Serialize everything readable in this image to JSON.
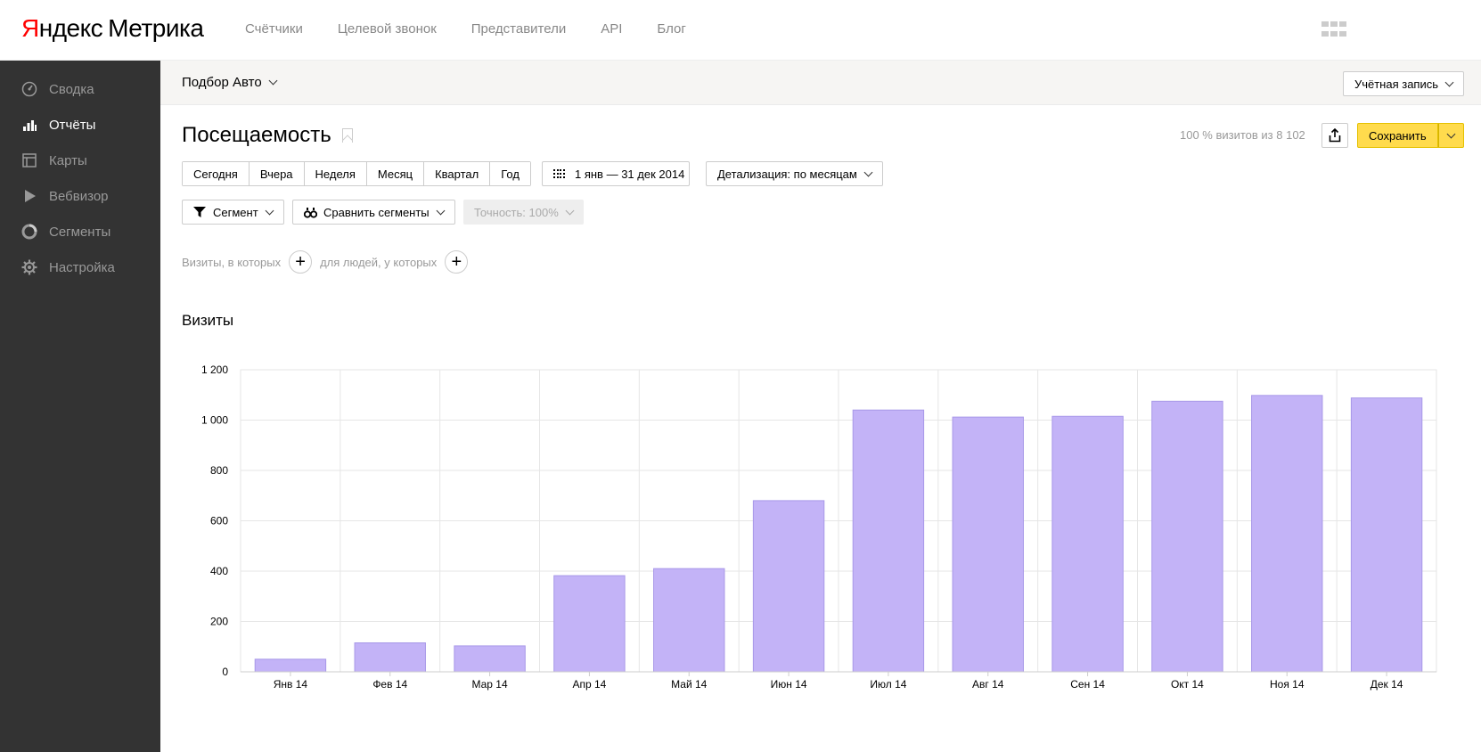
{
  "header": {
    "logo_brand": "Яндекс",
    "logo_product": "Метрика",
    "nav": [
      "Счётчики",
      "Целевой звонок",
      "Представители",
      "API",
      "Блог"
    ]
  },
  "sidebar": {
    "items": [
      {
        "label": "Сводка",
        "icon": "gauge-icon",
        "active": false
      },
      {
        "label": "Отчёты",
        "icon": "bar-chart-icon",
        "active": true
      },
      {
        "label": "Карты",
        "icon": "map-icon",
        "active": false
      },
      {
        "label": "Вебвизор",
        "icon": "play-icon",
        "active": false
      },
      {
        "label": "Сегменты",
        "icon": "segment-icon",
        "active": false
      },
      {
        "label": "Настройка",
        "icon": "gear-icon",
        "active": false
      }
    ]
  },
  "subbar": {
    "counter": "Подбор Авто",
    "account": "Учётная запись"
  },
  "report": {
    "title": "Посещаемость",
    "visits_info": "100 % визитов из 8 102",
    "save_label": "Сохранить",
    "periods": [
      "Сегодня",
      "Вчера",
      "Неделя",
      "Месяц",
      "Квартал",
      "Год"
    ],
    "date_range": "1 янв — 31 дек 2014",
    "detail": "Детализация: по месяцам",
    "segment": "Сегмент",
    "compare": "Сравнить сегменты",
    "accuracy": "Точность: 100%",
    "filter_visits": "Визиты, в которых",
    "filter_people": "для людей, у которых"
  },
  "colors": {
    "bar": "#c3b3f7",
    "bar_stroke": "#a898e8",
    "sidebar_bg": "#333333",
    "save_btn": "#ffdb4d"
  },
  "chart_data": {
    "type": "bar",
    "title": "Визиты",
    "categories": [
      "Янв 14",
      "Фев 14",
      "Мар 14",
      "Апр 14",
      "Май 14",
      "Июн 14",
      "Июл 14",
      "Авг 14",
      "Сен 14",
      "Окт 14",
      "Ноя 14",
      "Дек 14"
    ],
    "values": [
      50,
      115,
      103,
      382,
      410,
      680,
      1040,
      1012,
      1015,
      1075,
      1098,
      1088
    ],
    "y_ticks": [
      "0",
      "200",
      "400",
      "600",
      "800",
      "1 000",
      "1 200"
    ],
    "ylim": [
      0,
      1200
    ],
    "grid": true
  }
}
